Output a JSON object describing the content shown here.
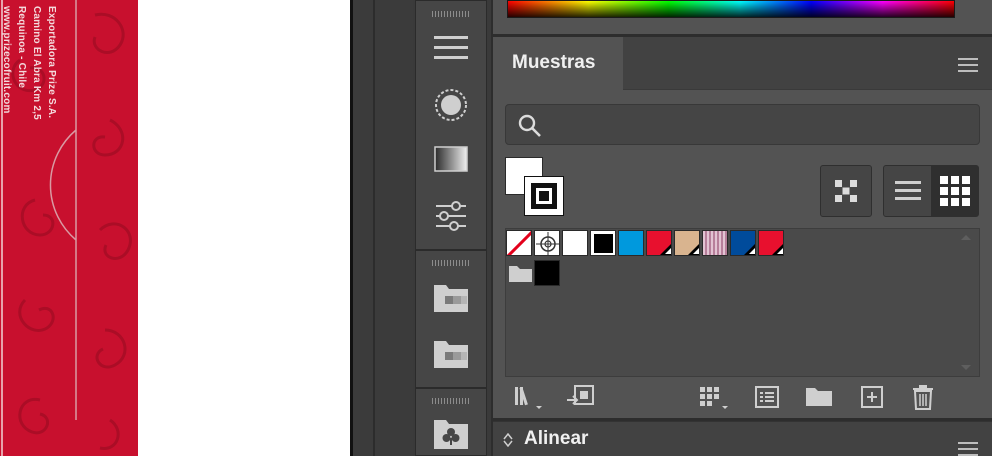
{
  "artwork": {
    "text_lines": [
      "Exportadora Prize S.A.",
      "Camino El Abra Km 2,5",
      "Requinoa - Chile",
      "www.prizecofruit.com"
    ],
    "background_color": "#c8102e"
  },
  "dock": {
    "icons": [
      "menu-lines-icon",
      "dotted-circle-icon",
      "gradient-icon",
      "sliders-icon",
      "folder-swatch-icon",
      "folder-swatch-icon",
      "club-folder-icon"
    ]
  },
  "swatches_panel": {
    "tab_label": "Muestras",
    "search_placeholder": "",
    "swatch_colors": [
      "none",
      "registration",
      "#ffffff",
      "#000000",
      "#0099dd",
      "#e8102e",
      "#d9b48f",
      "pattern-pink",
      "#004b9b",
      "#e8102e"
    ],
    "group_swatches": [
      "#000000"
    ],
    "footer_buttons": [
      "libraries-icon",
      "place-swatches-icon",
      "swatch-options-icon",
      "swatch-list-icon",
      "new-group-icon",
      "new-swatch-icon",
      "delete-icon"
    ]
  },
  "align_panel": {
    "tab_label": "Alinear"
  },
  "colors": {
    "panel_bg": "#535353",
    "tabbar_bg": "#424242",
    "accent_red": "#c8102e"
  }
}
